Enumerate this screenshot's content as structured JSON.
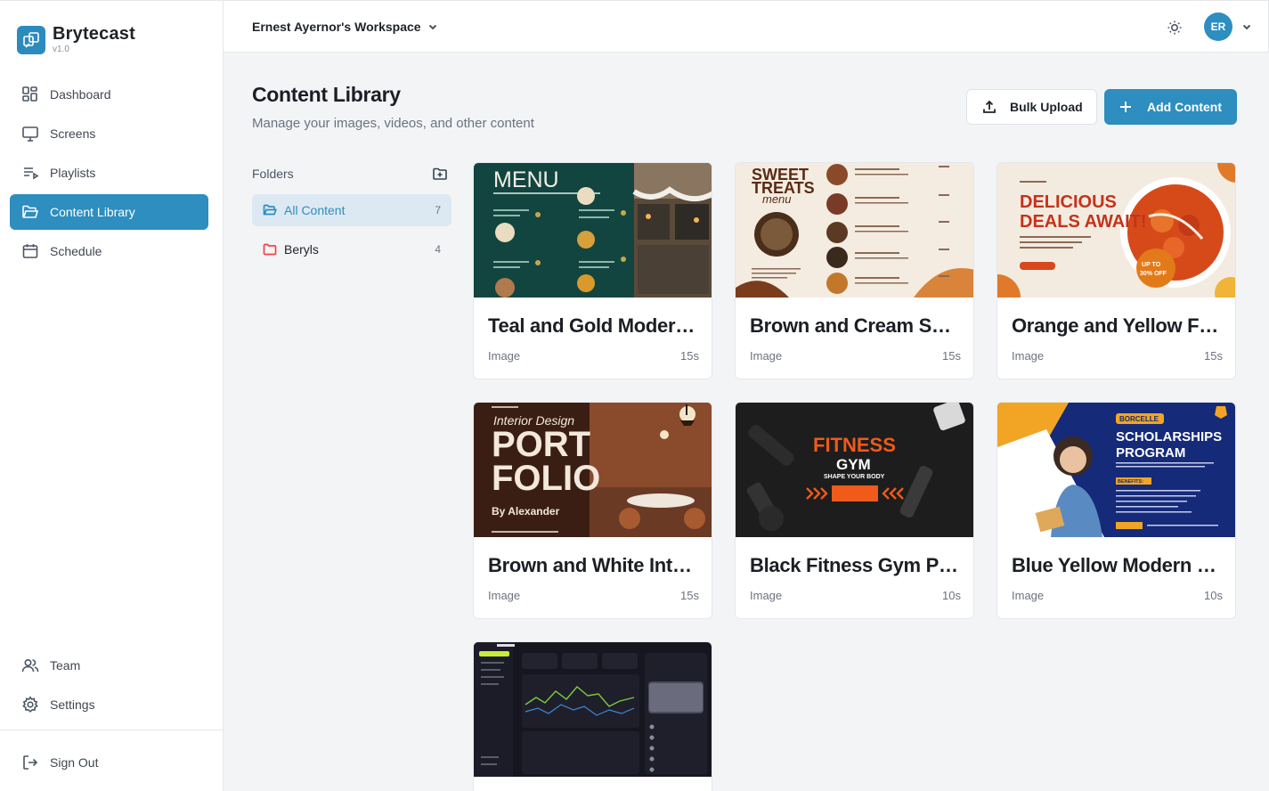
{
  "app": {
    "name": "Brytecast",
    "version": "v1.0"
  },
  "sidebar": {
    "items": [
      {
        "label": "Dashboard"
      },
      {
        "label": "Screens"
      },
      {
        "label": "Playlists"
      },
      {
        "label": "Content Library"
      },
      {
        "label": "Schedule"
      }
    ],
    "bottom": [
      {
        "label": "Team"
      },
      {
        "label": "Settings"
      }
    ],
    "signout": "Sign Out"
  },
  "topbar": {
    "workspace": "Ernest Ayernor's Workspace",
    "avatar_initials": "ER"
  },
  "page": {
    "title": "Content Library",
    "subtitle": "Manage your images, videos, and other content",
    "bulk_upload": "Bulk Upload",
    "add_content": "Add Content"
  },
  "folders": {
    "title": "Folders",
    "items": [
      {
        "name": "All Content",
        "count": "7"
      },
      {
        "name": "Beryls",
        "count": "4"
      }
    ]
  },
  "cards": [
    {
      "title": "Teal and Gold Modern Menu",
      "type": "Image",
      "duration": "15s",
      "thumb_text": [
        "MENU"
      ]
    },
    {
      "title": "Brown and Cream Sweet Treats Menu",
      "type": "Image",
      "duration": "15s",
      "thumb_text": [
        "SWEET",
        "TREATS",
        "menu"
      ]
    },
    {
      "title": "Orange and Yellow Food Promo",
      "type": "Image",
      "duration": "15s",
      "thumb_text": [
        "DELICIOUS",
        "DEALS AWAIT!",
        "UP TO",
        "30% OFF"
      ]
    },
    {
      "title": "Brown and White Interior Portfolio",
      "type": "Image",
      "duration": "15s",
      "thumb_text": [
        "Interior Design",
        "PORT",
        "FOLIO",
        "By Alexander"
      ]
    },
    {
      "title": "Black Fitness Gym Poster",
      "type": "Image",
      "duration": "10s",
      "thumb_text": [
        "FITNESS",
        "GYM",
        "SHAPE YOUR BODY"
      ]
    },
    {
      "title": "Blue Yellow Modern Scholarship",
      "type": "Image",
      "duration": "10s",
      "thumb_text": [
        "BORCELLE",
        "SCHOLARSHIPS",
        "PROGRAM",
        "BENEFITS:"
      ]
    },
    {
      "title": "",
      "type": "",
      "duration": "",
      "thumb_text": []
    }
  ],
  "colors": {
    "accent": "#2d8ebf",
    "folder_red": "#ef4444"
  }
}
